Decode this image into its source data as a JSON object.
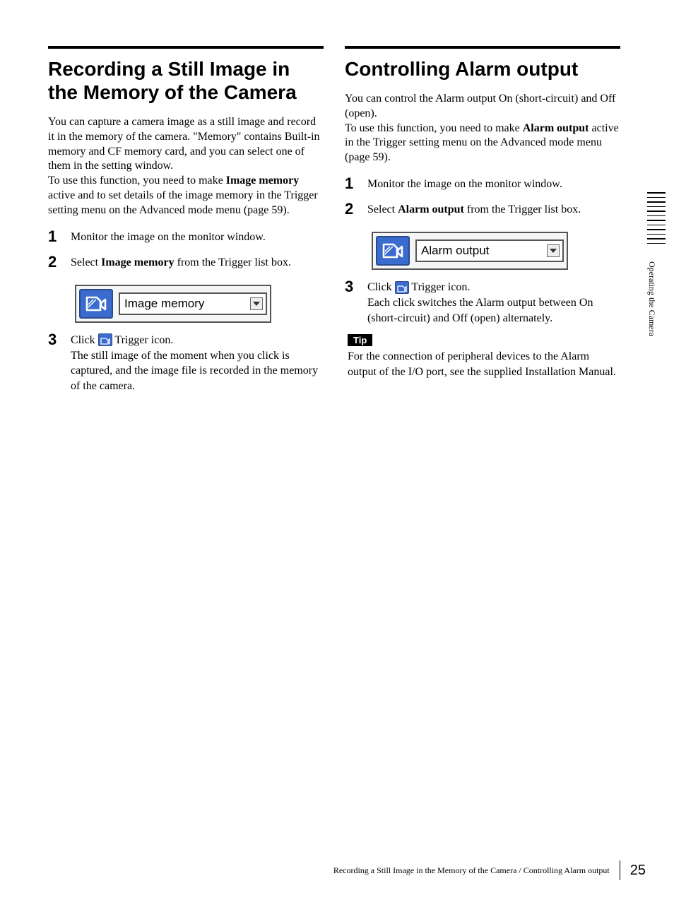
{
  "sidebar": {
    "section_label": "Operating the Camera"
  },
  "left": {
    "heading": "Recording a Still Image in the Memory of the Camera",
    "intro_a": "You can capture a camera image as a still image and record it in the memory of the camera. \"Memory\" contains Built-in memory and CF memory card, and you can select one of them in the setting window.",
    "intro_b_pre": "To use this function, you need to make ",
    "intro_b_bold": "Image memory",
    "intro_b_post": " active and to set details of the image memory in the Trigger setting menu on the Advanced mode menu (page 59).",
    "step1_num": "1",
    "step1_text": "Monitor the image on the monitor window.",
    "step2_num": "2",
    "step2_pre": "Select ",
    "step2_bold": "Image memory",
    "step2_post": " from the Trigger list box.",
    "select_value": "Image memory",
    "step3_num": "3",
    "step3_click": "Click ",
    "step3_trigger": " Trigger icon.",
    "step3_body": "The still image of the moment when you click is captured, and the image file is recorded in the memory of the camera."
  },
  "right": {
    "heading": "Controlling Alarm output",
    "intro_a": "You can control the Alarm output On (short-circuit) and Off (open).",
    "intro_b_pre": "To use this function, you need to make ",
    "intro_b_bold": "Alarm output",
    "intro_b_post": " active in the Trigger setting menu on the Advanced mode menu (page 59).",
    "step1_num": "1",
    "step1_text": "Monitor the image on the monitor window.",
    "step2_num": "2",
    "step2_pre": "Select ",
    "step2_bold": "Alarm output",
    "step2_post": " from the Trigger list box.",
    "select_value": "Alarm output",
    "step3_num": "3",
    "step3_click": "Click ",
    "step3_trigger": " Trigger icon.",
    "step3_body": "Each click switches the Alarm output between On (short-circuit) and Off (open) alternately.",
    "tip_label": "Tip",
    "tip_text": "For the connection of peripheral devices to the Alarm output of the I/O port, see the supplied Installation Manual."
  },
  "footer": {
    "text": "Recording a Still Image in the Memory of the Camera / Controlling Alarm output",
    "page": "25"
  }
}
